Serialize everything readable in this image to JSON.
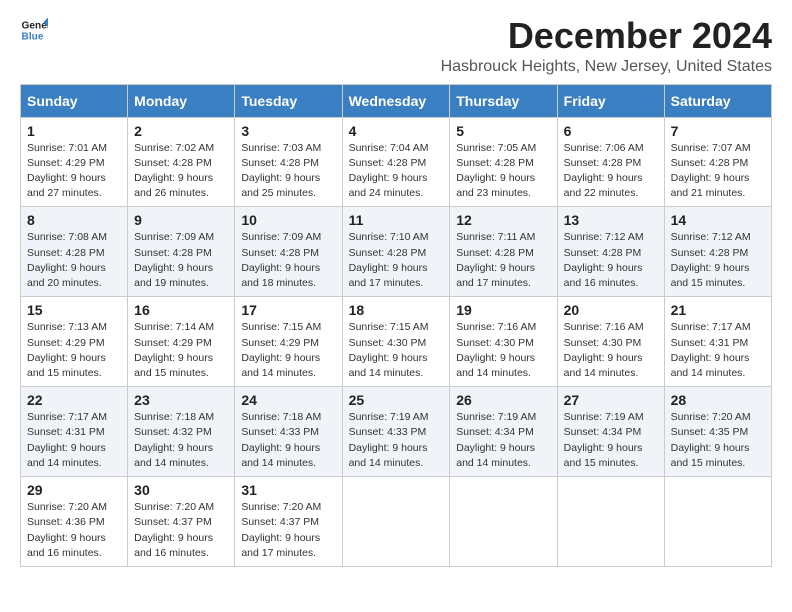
{
  "logo": {
    "line1": "General",
    "line2": "Blue"
  },
  "title": "December 2024",
  "location": "Hasbrouck Heights, New Jersey, United States",
  "days_of_week": [
    "Sunday",
    "Monday",
    "Tuesday",
    "Wednesday",
    "Thursday",
    "Friday",
    "Saturday"
  ],
  "weeks": [
    [
      {
        "day": "1",
        "sunrise": "7:01 AM",
        "sunset": "4:29 PM",
        "daylight": "9 hours and 27 minutes."
      },
      {
        "day": "2",
        "sunrise": "7:02 AM",
        "sunset": "4:28 PM",
        "daylight": "9 hours and 26 minutes."
      },
      {
        "day": "3",
        "sunrise": "7:03 AM",
        "sunset": "4:28 PM",
        "daylight": "9 hours and 25 minutes."
      },
      {
        "day": "4",
        "sunrise": "7:04 AM",
        "sunset": "4:28 PM",
        "daylight": "9 hours and 24 minutes."
      },
      {
        "day": "5",
        "sunrise": "7:05 AM",
        "sunset": "4:28 PM",
        "daylight": "9 hours and 23 minutes."
      },
      {
        "day": "6",
        "sunrise": "7:06 AM",
        "sunset": "4:28 PM",
        "daylight": "9 hours and 22 minutes."
      },
      {
        "day": "7",
        "sunrise": "7:07 AM",
        "sunset": "4:28 PM",
        "daylight": "9 hours and 21 minutes."
      }
    ],
    [
      {
        "day": "8",
        "sunrise": "7:08 AM",
        "sunset": "4:28 PM",
        "daylight": "9 hours and 20 minutes."
      },
      {
        "day": "9",
        "sunrise": "7:09 AM",
        "sunset": "4:28 PM",
        "daylight": "9 hours and 19 minutes."
      },
      {
        "day": "10",
        "sunrise": "7:09 AM",
        "sunset": "4:28 PM",
        "daylight": "9 hours and 18 minutes."
      },
      {
        "day": "11",
        "sunrise": "7:10 AM",
        "sunset": "4:28 PM",
        "daylight": "9 hours and 17 minutes."
      },
      {
        "day": "12",
        "sunrise": "7:11 AM",
        "sunset": "4:28 PM",
        "daylight": "9 hours and 17 minutes."
      },
      {
        "day": "13",
        "sunrise": "7:12 AM",
        "sunset": "4:28 PM",
        "daylight": "9 hours and 16 minutes."
      },
      {
        "day": "14",
        "sunrise": "7:12 AM",
        "sunset": "4:28 PM",
        "daylight": "9 hours and 15 minutes."
      }
    ],
    [
      {
        "day": "15",
        "sunrise": "7:13 AM",
        "sunset": "4:29 PM",
        "daylight": "9 hours and 15 minutes."
      },
      {
        "day": "16",
        "sunrise": "7:14 AM",
        "sunset": "4:29 PM",
        "daylight": "9 hours and 15 minutes."
      },
      {
        "day": "17",
        "sunrise": "7:15 AM",
        "sunset": "4:29 PM",
        "daylight": "9 hours and 14 minutes."
      },
      {
        "day": "18",
        "sunrise": "7:15 AM",
        "sunset": "4:30 PM",
        "daylight": "9 hours and 14 minutes."
      },
      {
        "day": "19",
        "sunrise": "7:16 AM",
        "sunset": "4:30 PM",
        "daylight": "9 hours and 14 minutes."
      },
      {
        "day": "20",
        "sunrise": "7:16 AM",
        "sunset": "4:30 PM",
        "daylight": "9 hours and 14 minutes."
      },
      {
        "day": "21",
        "sunrise": "7:17 AM",
        "sunset": "4:31 PM",
        "daylight": "9 hours and 14 minutes."
      }
    ],
    [
      {
        "day": "22",
        "sunrise": "7:17 AM",
        "sunset": "4:31 PM",
        "daylight": "9 hours and 14 minutes."
      },
      {
        "day": "23",
        "sunrise": "7:18 AM",
        "sunset": "4:32 PM",
        "daylight": "9 hours and 14 minutes."
      },
      {
        "day": "24",
        "sunrise": "7:18 AM",
        "sunset": "4:33 PM",
        "daylight": "9 hours and 14 minutes."
      },
      {
        "day": "25",
        "sunrise": "7:19 AM",
        "sunset": "4:33 PM",
        "daylight": "9 hours and 14 minutes."
      },
      {
        "day": "26",
        "sunrise": "7:19 AM",
        "sunset": "4:34 PM",
        "daylight": "9 hours and 14 minutes."
      },
      {
        "day": "27",
        "sunrise": "7:19 AM",
        "sunset": "4:34 PM",
        "daylight": "9 hours and 15 minutes."
      },
      {
        "day": "28",
        "sunrise": "7:20 AM",
        "sunset": "4:35 PM",
        "daylight": "9 hours and 15 minutes."
      }
    ],
    [
      {
        "day": "29",
        "sunrise": "7:20 AM",
        "sunset": "4:36 PM",
        "daylight": "9 hours and 16 minutes."
      },
      {
        "day": "30",
        "sunrise": "7:20 AM",
        "sunset": "4:37 PM",
        "daylight": "9 hours and 16 minutes."
      },
      {
        "day": "31",
        "sunrise": "7:20 AM",
        "sunset": "4:37 PM",
        "daylight": "9 hours and 17 minutes."
      },
      null,
      null,
      null,
      null
    ]
  ],
  "labels": {
    "sunrise": "Sunrise:",
    "sunset": "Sunset:",
    "daylight": "Daylight:"
  }
}
